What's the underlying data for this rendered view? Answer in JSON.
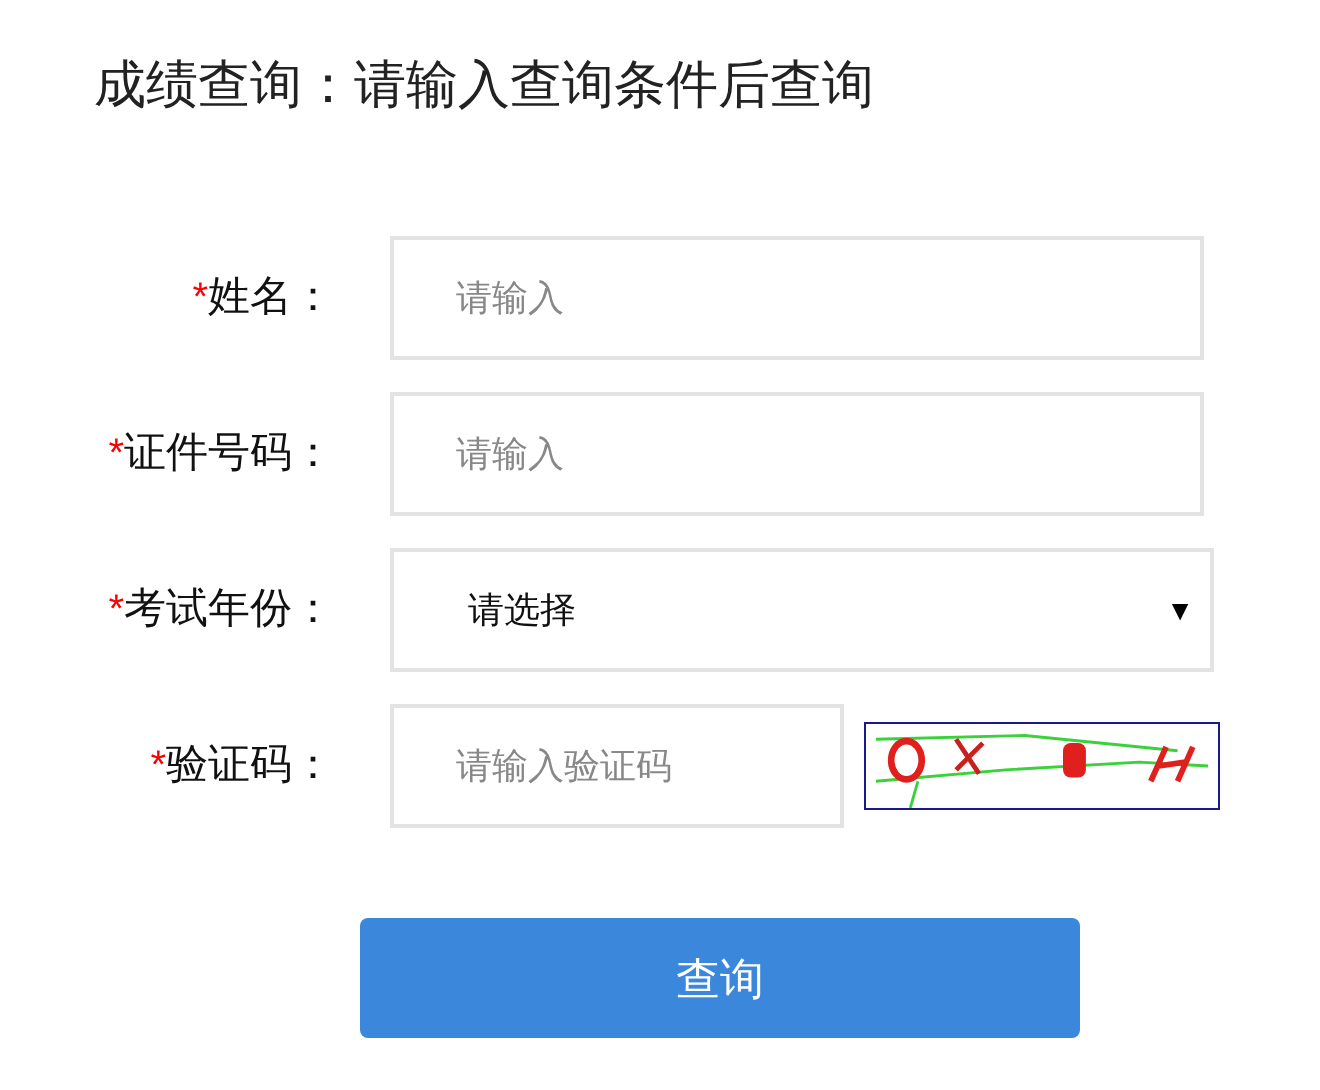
{
  "title": "成绩查询：请输入查询条件后查询",
  "fields": [
    {
      "kind": "text",
      "mark": "*",
      "label": "姓名：",
      "placeholder": "请输入"
    },
    {
      "kind": "text",
      "mark": "*",
      "label": "证件号码：",
      "placeholder": "请输入"
    },
    {
      "kind": "select",
      "mark": "*",
      "label": "考试年份：",
      "value": "请选择",
      "arrow": "▼"
    },
    {
      "kind": "captcha",
      "mark": "*",
      "label": "验证码：",
      "placeholder": "请输入验证码"
    }
  ],
  "submit": "查询"
}
